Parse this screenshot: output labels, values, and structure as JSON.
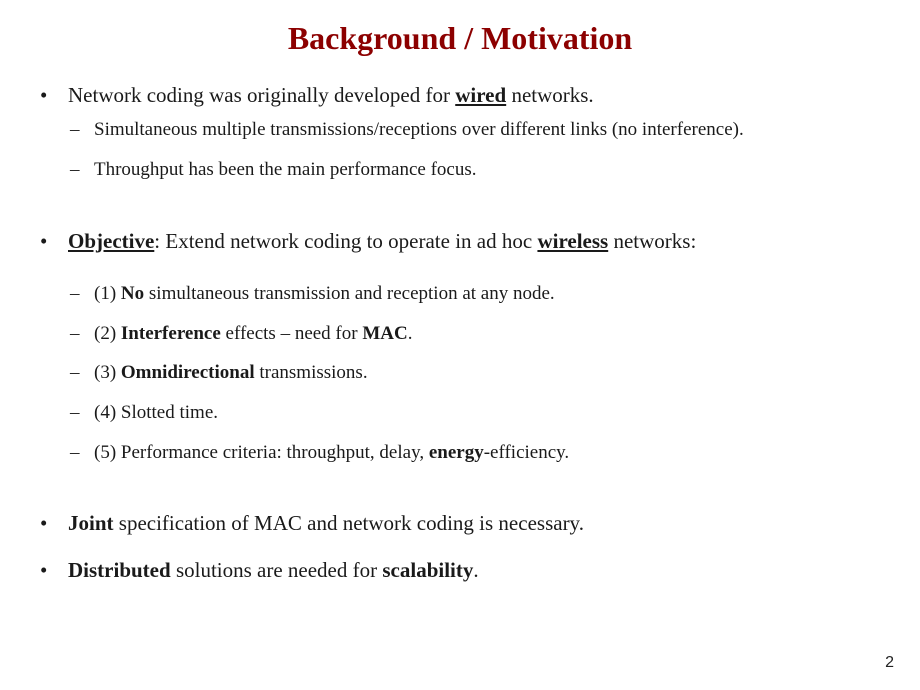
{
  "title": "Background / Motivation",
  "page_number": "2",
  "b1": {
    "pre": "Network coding was originally developed for ",
    "wired": "wired",
    "post": " networks."
  },
  "b1s": {
    "a": "Simultaneous multiple transmissions/receptions over different links (no interference).",
    "b": "Throughput has been the main performance focus."
  },
  "b2": {
    "obj": "Objective",
    "mid": ":  Extend network coding to operate in ad hoc ",
    "wireless": "wireless",
    "post": " networks:"
  },
  "b2s": {
    "a_pre": "(1) ",
    "a_no": "No",
    "a_post": " simultaneous transmission and reception at any node.",
    "b_pre": "(2) ",
    "b_intf": "Interference",
    "b_mid": " effects – need for ",
    "b_mac": "MAC",
    "b_post": ".",
    "c_pre": "(3) ",
    "c_omni": "Omnidirectional",
    "c_post": " transmissions.",
    "d": "(4) Slotted time.",
    "e_pre": "(5) Performance criteria: throughput, delay, ",
    "e_energy": "energy",
    "e_post": "-efficiency."
  },
  "b3": {
    "joint": "Joint",
    "post": " specification of MAC and network coding is necessary."
  },
  "b4": {
    "dist": "Distributed",
    "mid": " solutions are needed for ",
    "scal": "scalability",
    "post": "."
  }
}
